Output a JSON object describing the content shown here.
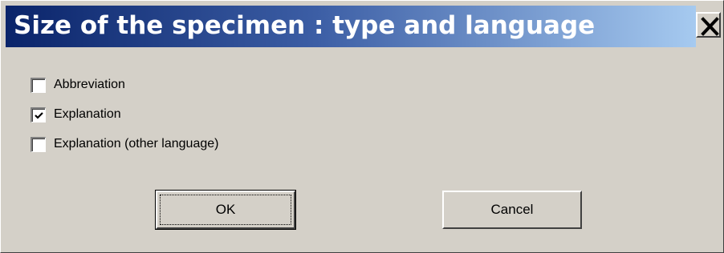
{
  "window": {
    "title": "Size of the specimen : type and language",
    "close_glyph": "close-icon"
  },
  "options": [
    {
      "label": "Abbreviation",
      "checked": false
    },
    {
      "label": "Explanation",
      "checked": true
    },
    {
      "label": "Explanation (other language)",
      "checked": false
    }
  ],
  "buttons": {
    "ok_label": "OK",
    "cancel_label": "Cancel"
  },
  "colors": {
    "title_gradient_start": "#0a246a",
    "title_gradient_end": "#a6caf0",
    "dialog_face": "#d4d0c8"
  }
}
